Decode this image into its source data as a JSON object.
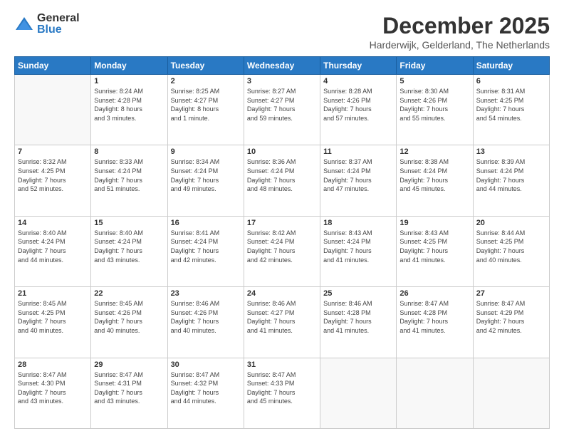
{
  "logo": {
    "general": "General",
    "blue": "Blue"
  },
  "header": {
    "month": "December 2025",
    "location": "Harderwijk, Gelderland, The Netherlands"
  },
  "weekdays": [
    "Sunday",
    "Monday",
    "Tuesday",
    "Wednesday",
    "Thursday",
    "Friday",
    "Saturday"
  ],
  "weeks": [
    [
      {
        "day": "",
        "info": ""
      },
      {
        "day": "1",
        "info": "Sunrise: 8:24 AM\nSunset: 4:28 PM\nDaylight: 8 hours\nand 3 minutes."
      },
      {
        "day": "2",
        "info": "Sunrise: 8:25 AM\nSunset: 4:27 PM\nDaylight: 8 hours\nand 1 minute."
      },
      {
        "day": "3",
        "info": "Sunrise: 8:27 AM\nSunset: 4:27 PM\nDaylight: 7 hours\nand 59 minutes."
      },
      {
        "day": "4",
        "info": "Sunrise: 8:28 AM\nSunset: 4:26 PM\nDaylight: 7 hours\nand 57 minutes."
      },
      {
        "day": "5",
        "info": "Sunrise: 8:30 AM\nSunset: 4:26 PM\nDaylight: 7 hours\nand 55 minutes."
      },
      {
        "day": "6",
        "info": "Sunrise: 8:31 AM\nSunset: 4:25 PM\nDaylight: 7 hours\nand 54 minutes."
      }
    ],
    [
      {
        "day": "7",
        "info": "Sunrise: 8:32 AM\nSunset: 4:25 PM\nDaylight: 7 hours\nand 52 minutes."
      },
      {
        "day": "8",
        "info": "Sunrise: 8:33 AM\nSunset: 4:24 PM\nDaylight: 7 hours\nand 51 minutes."
      },
      {
        "day": "9",
        "info": "Sunrise: 8:34 AM\nSunset: 4:24 PM\nDaylight: 7 hours\nand 49 minutes."
      },
      {
        "day": "10",
        "info": "Sunrise: 8:36 AM\nSunset: 4:24 PM\nDaylight: 7 hours\nand 48 minutes."
      },
      {
        "day": "11",
        "info": "Sunrise: 8:37 AM\nSunset: 4:24 PM\nDaylight: 7 hours\nand 47 minutes."
      },
      {
        "day": "12",
        "info": "Sunrise: 8:38 AM\nSunset: 4:24 PM\nDaylight: 7 hours\nand 45 minutes."
      },
      {
        "day": "13",
        "info": "Sunrise: 8:39 AM\nSunset: 4:24 PM\nDaylight: 7 hours\nand 44 minutes."
      }
    ],
    [
      {
        "day": "14",
        "info": "Sunrise: 8:40 AM\nSunset: 4:24 PM\nDaylight: 7 hours\nand 44 minutes."
      },
      {
        "day": "15",
        "info": "Sunrise: 8:40 AM\nSunset: 4:24 PM\nDaylight: 7 hours\nand 43 minutes."
      },
      {
        "day": "16",
        "info": "Sunrise: 8:41 AM\nSunset: 4:24 PM\nDaylight: 7 hours\nand 42 minutes."
      },
      {
        "day": "17",
        "info": "Sunrise: 8:42 AM\nSunset: 4:24 PM\nDaylight: 7 hours\nand 42 minutes."
      },
      {
        "day": "18",
        "info": "Sunrise: 8:43 AM\nSunset: 4:24 PM\nDaylight: 7 hours\nand 41 minutes."
      },
      {
        "day": "19",
        "info": "Sunrise: 8:43 AM\nSunset: 4:25 PM\nDaylight: 7 hours\nand 41 minutes."
      },
      {
        "day": "20",
        "info": "Sunrise: 8:44 AM\nSunset: 4:25 PM\nDaylight: 7 hours\nand 40 minutes."
      }
    ],
    [
      {
        "day": "21",
        "info": "Sunrise: 8:45 AM\nSunset: 4:25 PM\nDaylight: 7 hours\nand 40 minutes."
      },
      {
        "day": "22",
        "info": "Sunrise: 8:45 AM\nSunset: 4:26 PM\nDaylight: 7 hours\nand 40 minutes."
      },
      {
        "day": "23",
        "info": "Sunrise: 8:46 AM\nSunset: 4:26 PM\nDaylight: 7 hours\nand 40 minutes."
      },
      {
        "day": "24",
        "info": "Sunrise: 8:46 AM\nSunset: 4:27 PM\nDaylight: 7 hours\nand 41 minutes."
      },
      {
        "day": "25",
        "info": "Sunrise: 8:46 AM\nSunset: 4:28 PM\nDaylight: 7 hours\nand 41 minutes."
      },
      {
        "day": "26",
        "info": "Sunrise: 8:47 AM\nSunset: 4:28 PM\nDaylight: 7 hours\nand 41 minutes."
      },
      {
        "day": "27",
        "info": "Sunrise: 8:47 AM\nSunset: 4:29 PM\nDaylight: 7 hours\nand 42 minutes."
      }
    ],
    [
      {
        "day": "28",
        "info": "Sunrise: 8:47 AM\nSunset: 4:30 PM\nDaylight: 7 hours\nand 43 minutes."
      },
      {
        "day": "29",
        "info": "Sunrise: 8:47 AM\nSunset: 4:31 PM\nDaylight: 7 hours\nand 43 minutes."
      },
      {
        "day": "30",
        "info": "Sunrise: 8:47 AM\nSunset: 4:32 PM\nDaylight: 7 hours\nand 44 minutes."
      },
      {
        "day": "31",
        "info": "Sunrise: 8:47 AM\nSunset: 4:33 PM\nDaylight: 7 hours\nand 45 minutes."
      },
      {
        "day": "",
        "info": ""
      },
      {
        "day": "",
        "info": ""
      },
      {
        "day": "",
        "info": ""
      }
    ]
  ]
}
